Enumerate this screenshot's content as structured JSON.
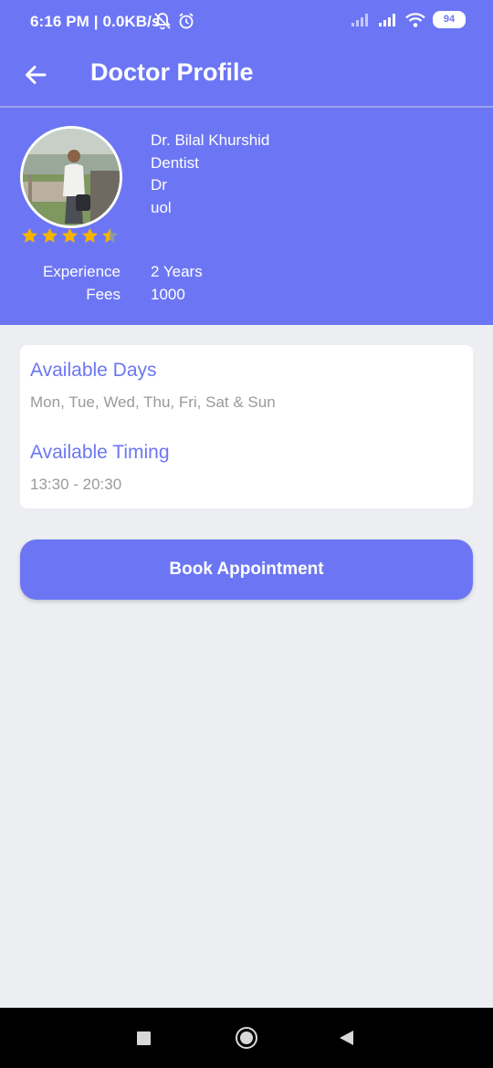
{
  "status_bar": {
    "time": "6:16 PM | 0.0KB/s",
    "battery": "94",
    "icons": [
      "muted-bell-icon",
      "alarm-icon",
      "signal-icon",
      "signal-icon",
      "wifi-icon",
      "battery-icon"
    ]
  },
  "app_bar": {
    "title": "Doctor Profile",
    "back_icon": "arrow-left-icon"
  },
  "profile": {
    "name": "Dr. Bilal Khurshid",
    "specialty": "Dentist",
    "title": "Dr",
    "institution": "uol",
    "rating": 4.5,
    "rating_max": 5,
    "star_color": "#f5b400",
    "experience_label": "Experience",
    "experience_value": "2 Years",
    "fees_label": "Fees",
    "fees_value": "1000"
  },
  "availability": {
    "days_heading": "Available Days",
    "days_value": "Mon, Tue, Wed, Thu, Fri, Sat & Sun",
    "timing_heading": "Available Timing",
    "timing_value": "13:30 - 20:30"
  },
  "actions": {
    "book_label": "Book Appointment"
  },
  "theme": {
    "accent": "#6c76f4",
    "background": "#eceef1",
    "muted_text": "#9a9a9a"
  }
}
